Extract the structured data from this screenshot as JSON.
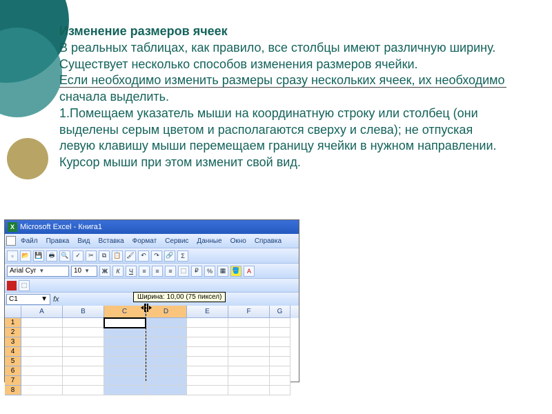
{
  "slide": {
    "title": "Изменение размеров ячеек",
    "p1": "В реальных таблицах, как правило, все столбцы имеют различную ширину. Существует несколько способов изменения размеров ячейки.",
    "p2": "Если необходимо изменить размеры сразу нескольких ячеек, их необходимо сначала выделить.",
    "p3": "1.Помещаем указатель мыши на координатную строку или столбец (они выделены серым цветом и располагаются сверху и слева); не отпуская левую клавишу мыши перемещаем границу ячейки в нужном направлении. Курсор мыши при этом изменит свой вид."
  },
  "excel": {
    "app_title": "Microsoft Excel - Книга1",
    "menus": [
      "Файл",
      "Правка",
      "Вид",
      "Вставка",
      "Формат",
      "Сервис",
      "Данные",
      "Окно",
      "Справка"
    ],
    "font_name": "Arial Cyr",
    "font_size": "10",
    "name_box": "C1",
    "tooltip": "Ширина: 10,00 (75 пиксел)",
    "columns": [
      {
        "label": "A",
        "w": 60,
        "sel": false
      },
      {
        "label": "B",
        "w": 60,
        "sel": false
      },
      {
        "label": "C",
        "w": 60,
        "sel": true
      },
      {
        "label": "D",
        "w": 60,
        "sel": true
      },
      {
        "label": "E",
        "w": 60,
        "sel": false
      },
      {
        "label": "F",
        "w": 60,
        "sel": false
      },
      {
        "label": "G",
        "w": 30,
        "sel": false
      }
    ],
    "rows": [
      {
        "n": "1",
        "sel": true,
        "active": true
      },
      {
        "n": "2",
        "sel": true
      },
      {
        "n": "3",
        "sel": true
      },
      {
        "n": "4",
        "sel": true
      },
      {
        "n": "5",
        "sel": true
      },
      {
        "n": "6",
        "sel": true
      },
      {
        "n": "7",
        "sel": true
      },
      {
        "n": "8",
        "sel": true
      }
    ]
  }
}
